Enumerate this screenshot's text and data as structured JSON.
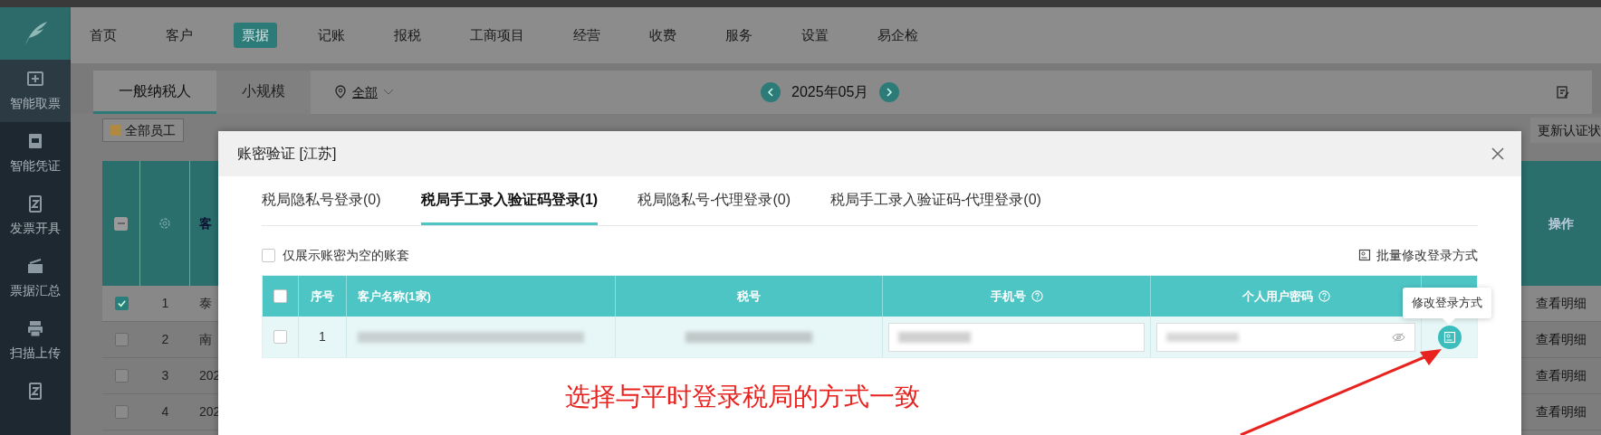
{
  "nav": {
    "items": [
      {
        "label": "首页",
        "selected": false
      },
      {
        "label": "客户",
        "selected": false
      },
      {
        "label": "票据",
        "selected": true
      },
      {
        "label": "记账",
        "selected": false
      },
      {
        "label": "报税",
        "selected": false
      },
      {
        "label": "工商项目",
        "selected": false
      },
      {
        "label": "经营",
        "selected": false
      },
      {
        "label": "收费",
        "selected": false
      },
      {
        "label": "服务",
        "selected": false
      },
      {
        "label": "设置",
        "selected": false
      },
      {
        "label": "易企检",
        "selected": false
      }
    ]
  },
  "sidebar": {
    "items": [
      {
        "label": "智能取票",
        "selected": true
      },
      {
        "label": "智能凭证",
        "selected": false
      },
      {
        "label": "发票开具",
        "selected": false
      },
      {
        "label": "票据汇总",
        "selected": false
      },
      {
        "label": "扫描上传",
        "selected": false
      }
    ]
  },
  "subheader": {
    "tabs": [
      {
        "label": "一般纳税人",
        "selected": true
      },
      {
        "label": "小规模",
        "selected": false
      }
    ],
    "region": "全部",
    "month": "2025年05月"
  },
  "toolbar": {
    "staff_button": "全部员工",
    "update_button": "更新认证状"
  },
  "background_table": {
    "header_indeterminate": true,
    "column_3": "客",
    "action_header": "操作",
    "rows": [
      {
        "index": "1",
        "customer": "泰",
        "checked": true,
        "action": "查看明细"
      },
      {
        "index": "2",
        "customer": "南",
        "checked": false,
        "action": "查看明细"
      },
      {
        "index": "3",
        "customer": "202",
        "checked": false,
        "action": "查看明细"
      },
      {
        "index": "4",
        "customer": "202",
        "checked": false,
        "action": "查看明细"
      }
    ]
  },
  "dialog": {
    "title": "账密验证 [江苏]",
    "tabs": [
      {
        "label": "税局隐私号登录(0)",
        "selected": false
      },
      {
        "label": "税局手工录入验证码登录(1)",
        "selected": true
      },
      {
        "label": "税局隐私号-代理登录(0)",
        "selected": false
      },
      {
        "label": "税局手工录入验证码-代理登录(0)",
        "selected": false
      }
    ],
    "filter": {
      "label": "仅展示账密为空的账套",
      "checked": false
    },
    "batch_button": "批量修改登录方式",
    "table": {
      "header_checked": false,
      "columns": [
        {
          "label": "序号",
          "help": false
        },
        {
          "label": "客户名称(1家)",
          "help": false
        },
        {
          "label": "税号",
          "help": false
        },
        {
          "label": "手机号",
          "help": true
        },
        {
          "label": "个人用户密码",
          "help": true
        }
      ],
      "rows": [
        {
          "index": "1",
          "checked": false
        }
      ]
    },
    "tooltip": "修改登录方式"
  },
  "annotation": "选择与平时登录税局的方式一致"
}
